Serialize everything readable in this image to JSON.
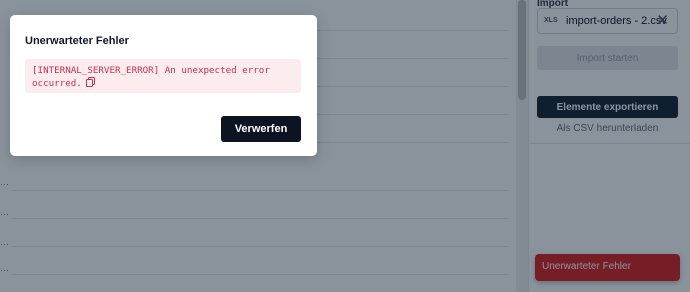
{
  "modal": {
    "title": "Unerwarteter Fehler",
    "error_message": "[INTERNAL_SERVER_ERROR] An unexpected error occurred.",
    "dismiss_label": "Verwerfen",
    "copy_icon": "copy-icon"
  },
  "side_panel": {
    "import_label": "Import",
    "file": {
      "badge": "XLS",
      "name": "import-orders - 2.csv",
      "remove_icon": "close-icon"
    },
    "import_button_label": "Import starten",
    "export_button_label": "Elemente exportieren",
    "csv_link_label": "Als CSV herunterladen"
  },
  "toast": {
    "message": "Unerwarteter Fehler"
  },
  "colors": {
    "overlay": "#0a1a2a",
    "error_text": "#c2334d",
    "error_bg": "#fdecee",
    "primary_button": "#0c1322",
    "toast_bg": "#dc2626"
  }
}
